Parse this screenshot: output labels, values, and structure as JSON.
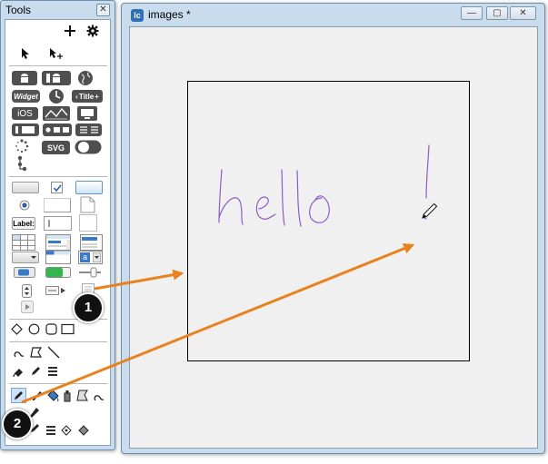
{
  "tools_window": {
    "title": "Tools",
    "close_glyph": "✕",
    "top_toolbar_icons": [
      "plus-icon",
      "gear-icon"
    ],
    "widget_label": "Widget",
    "title_button_label": "Title",
    "ios_label": "iOS",
    "svg_label": "SVG",
    "field_label": "Label:",
    "field_prefix": "a"
  },
  "images_window": {
    "title": "images *",
    "logo_text": "lc",
    "minimize_glyph": "—",
    "maximize_glyph": "▢",
    "close_glyph": "✕"
  },
  "callouts": [
    {
      "number": "1"
    },
    {
      "number": "2"
    }
  ],
  "colors": {
    "arrow": "#e8821e",
    "ink": "#8e5cc9",
    "window_frame": "#c9dced"
  }
}
